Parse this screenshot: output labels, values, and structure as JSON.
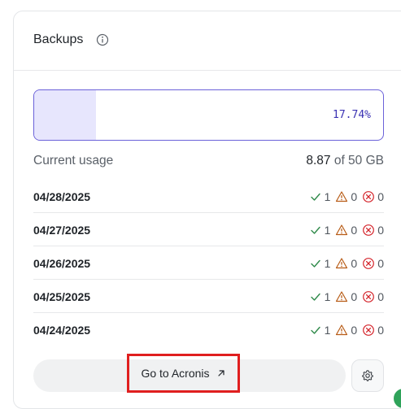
{
  "header": {
    "title": "Backups"
  },
  "usage": {
    "percent_label": "17.74%",
    "fraction": 0.1774,
    "label": "Current usage",
    "used": "8.87",
    "of_total": " of 50 GB"
  },
  "rows": [
    {
      "date": "04/28/2025",
      "success": "1",
      "warning": "0",
      "error": "0"
    },
    {
      "date": "04/27/2025",
      "success": "1",
      "warning": "0",
      "error": "0"
    },
    {
      "date": "04/26/2025",
      "success": "1",
      "warning": "0",
      "error": "0"
    },
    {
      "date": "04/25/2025",
      "success": "1",
      "warning": "0",
      "error": "0"
    },
    {
      "date": "04/24/2025",
      "success": "1",
      "warning": "0",
      "error": "0"
    }
  ],
  "footer": {
    "link_label": "Go to Acronis"
  },
  "colors": {
    "accent": "#6b62d9",
    "fill": "#e7e6fd",
    "success": "#2f8a4a",
    "warning": "#b85c17",
    "error": "#d4242b",
    "highlight": "#e01f1f"
  }
}
